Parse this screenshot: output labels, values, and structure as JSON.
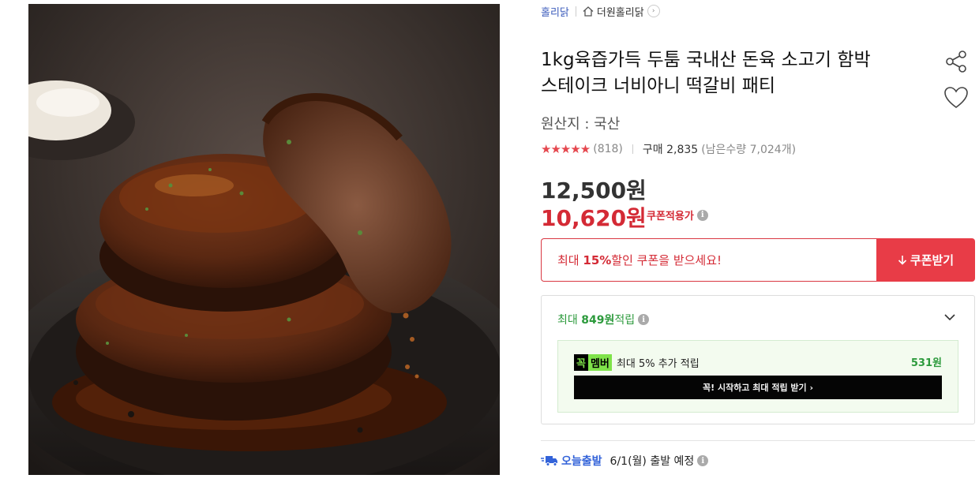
{
  "product_image": {
    "alt": "product-photo"
  },
  "breadcrumb": {
    "seller": "홀리닭",
    "store": "더원홀리닭",
    "arrow": "›"
  },
  "product": {
    "title_line1": "1kg육즙가득 두툼 국내산 돈육 소고기 함박",
    "title_line2": "스테이크 너비아니 떡갈비 패티",
    "origin": "원산지 : 국산"
  },
  "rating": {
    "stars": "★★★★★",
    "score": 4.5,
    "review_count": "(818)",
    "purchase": "구매 2,835",
    "stock": "(남은수량 7,024개)"
  },
  "price": {
    "original": "12,500원",
    "sale": "10,620원",
    "sale_label": "쿠폰적용가",
    "info_icon": "i"
  },
  "coupon": {
    "prefix": "최대 ",
    "percent": "15%",
    "suffix": " 할인 쿠폰을 받으세요!",
    "button": "쿠폰받기"
  },
  "points": {
    "prefix": "최대 ",
    "amount": "849원",
    "suffix": " 적립",
    "member_badge_a": "꼭",
    "member_badge_b": "멤버",
    "member_text": "최대 5% 추가 적립",
    "member_amount": "531원",
    "member_cta": "꼭! 시작하고 최대 적립 받기 ›"
  },
  "delivery": {
    "label": "오늘출발",
    "date": "6/1(월) 출발 예정"
  },
  "colors": {
    "accent_red": "#d42a35",
    "coupon_button": "#e83c47",
    "green": "#2c9a3c",
    "blue": "#3363d9",
    "seller_link": "#3b5bbb"
  }
}
